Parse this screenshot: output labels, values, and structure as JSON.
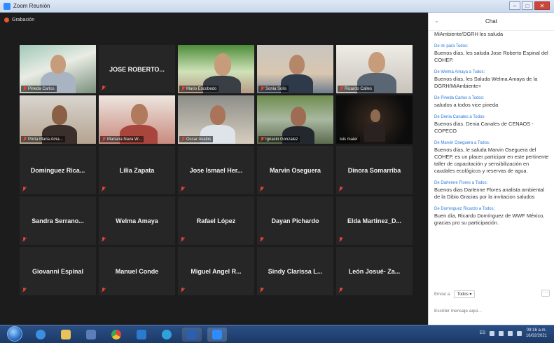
{
  "window": {
    "title": "Zoom Reunión",
    "controls": [
      "–",
      "□",
      "✕"
    ]
  },
  "recording": {
    "label": "Grabación"
  },
  "participants": [
    {
      "name": "Pineda Carlos",
      "video": true,
      "highlight": false
    },
    {
      "name": "JOSE ROBERTO...",
      "video": false,
      "highlight": false
    },
    {
      "name": "Mario Escobedo",
      "video": true,
      "highlight": true
    },
    {
      "name": "Sonia Solis",
      "video": true,
      "highlight": false
    },
    {
      "name": "Ricardo Calles",
      "video": true,
      "highlight": false
    },
    {
      "name": "Porta Maria Ama...",
      "video": true,
      "highlight": false
    },
    {
      "name": "Mariana Nava W...",
      "video": true,
      "highlight": false
    },
    {
      "name": "Oscar Avalos",
      "video": true,
      "highlight": false
    },
    {
      "name": "Ignacio Gonzalez",
      "video": true,
      "highlight": false
    },
    {
      "name": "luis maier",
      "video": true,
      "highlight": false
    },
    {
      "name": "Dominguez Rica...",
      "video": false
    },
    {
      "name": "Lilia Zapata",
      "video": false
    },
    {
      "name": "Jose Ismael Her...",
      "video": false
    },
    {
      "name": "Marvin Oseguera",
      "video": false
    },
    {
      "name": "Dinora Somarriba",
      "video": false
    },
    {
      "name": "Sandra Serrano...",
      "video": false
    },
    {
      "name": "Welma Amaya",
      "video": false
    },
    {
      "name": "Rafael López",
      "video": false
    },
    {
      "name": "Dayan Pichardo",
      "video": false
    },
    {
      "name": "Elda Martinez_D...",
      "video": false
    },
    {
      "name": "Giovanni Espinal",
      "video": false
    },
    {
      "name": "Manuel Conde",
      "video": false
    },
    {
      "name": "Miguel Angel R...",
      "video": false
    },
    {
      "name": "Sindy Clarissa L...",
      "video": false
    },
    {
      "name": "León Josué- Za...",
      "video": false
    }
  ],
  "chat": {
    "title": "Chat",
    "messages": [
      {
        "from": "",
        "text": "MiAmbiente/DGRH les saluda"
      },
      {
        "from": "De mi para Todos:",
        "text": "Buenos días, les saluda Jose Roberto Espinal del COHEP."
      },
      {
        "from": "De Welma Amaya a Todos:",
        "text": "Buenos días, les Saluda Welma Amaya de la DGRH/MiAmbiente+"
      },
      {
        "from": "De Pineda Carlos a Todos:",
        "text": "saludos a todos vice pineda"
      },
      {
        "from": "De Denia Canales a Todos:",
        "text": "Buenos días. Denia Canales de CENAOS - COPECO"
      },
      {
        "from": "De Marvin Oseguera a Todos:",
        "text": "Buenos días, le saluda Marvin Oseguera del COHEP, es un placer participar en este pertinente taller de capacitación y sensibilización en caudales ecológicos y reservas de agua."
      },
      {
        "from": "De Darlenne Flores a Todos:",
        "text": "Buenos dias Darlenne Flores analista ambiental de la Dibio.Gracias por la invitacion saludos"
      },
      {
        "from": "De Dominguez Ricardo a Todos:",
        "text": "Buen día, Ricardo Domínguez de WWF México, gracias pro su participación."
      }
    ],
    "send_to_label": "Enviar a:",
    "send_to_value": "Todos ▾",
    "more": "···",
    "input_placeholder": "Escribir mensaje aquí..."
  },
  "taskbar": {
    "time": "09:16 a.m.",
    "date": "16/02/2021",
    "tray_lang": "ES",
    "icons": [
      "start-orb",
      "internet-explorer-icon",
      "file-explorer-icon",
      "media-player-icon",
      "chrome-icon",
      "outlook-icon",
      "edge-icon",
      "word-icon",
      "zoom-icon"
    ]
  },
  "colors": {
    "highlight": "#c8d92c",
    "chat_link": "#2d7bd6",
    "mute": "#e0443a",
    "taskbar": "#1c3a68"
  }
}
